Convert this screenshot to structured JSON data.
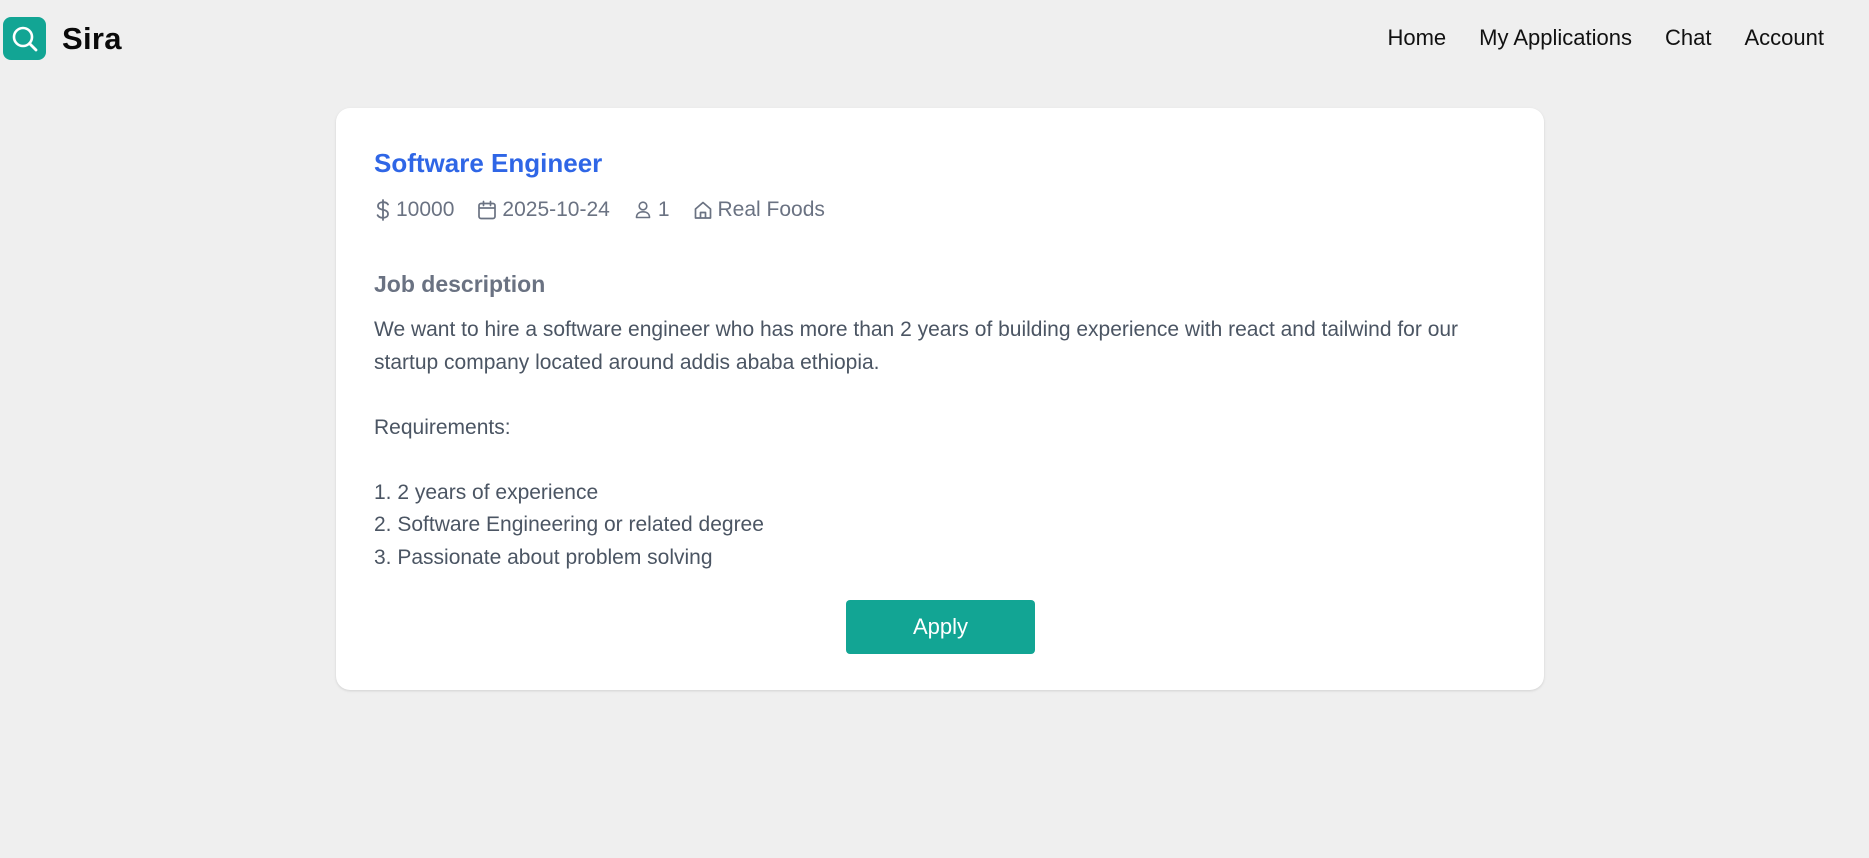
{
  "brand": {
    "name": "Sira",
    "logo_icon": "search-icon",
    "accent_color": "#12a594"
  },
  "nav": {
    "items": [
      {
        "label": "Home"
      },
      {
        "label": "My Applications"
      },
      {
        "label": "Chat"
      },
      {
        "label": "Account"
      }
    ]
  },
  "job": {
    "title": "Software Engineer",
    "title_color": "#2f66e6",
    "salary": "10000",
    "salary_icon": "dollar-icon",
    "date": "2025-10-24",
    "date_icon": "calendar-icon",
    "openings": "1",
    "openings_icon": "user-icon",
    "company": "Real Foods",
    "company_icon": "home-icon",
    "description_heading": "Job description",
    "description": "We want to hire a software engineer who has more than 2 years of building experience with react and tailwind for our startup company located around addis ababa ethiopia.\n\nRequirements:\n\n1. 2 years of experience\n2. Software Engineering or related degree\n3. Passionate about problem solving",
    "apply_label": "Apply"
  }
}
